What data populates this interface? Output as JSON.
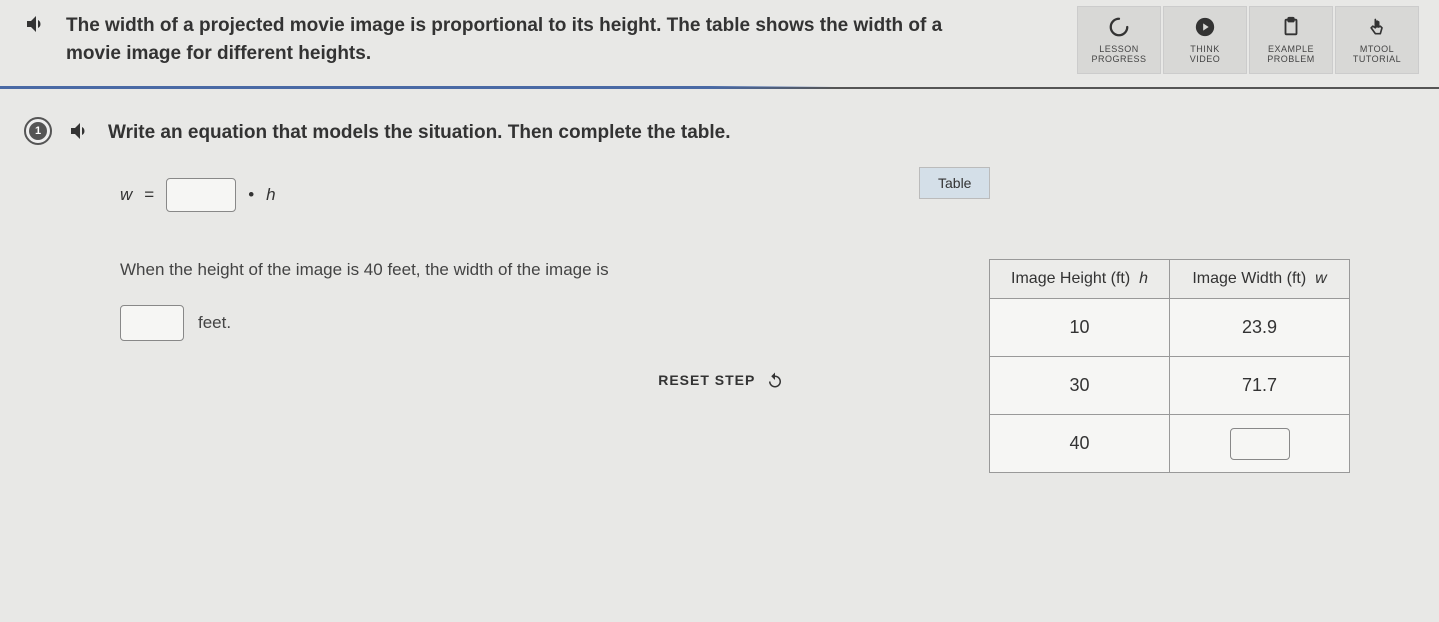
{
  "intro": "The width of a projected movie image is proportional to its height. The table shows the width of a movie image for different heights.",
  "toolbar": {
    "lesson_progress": "LESSON\nPROGRESS",
    "think_video": "THINK\nVIDEO",
    "example_problem": "EXAMPLE\nPROBLEM",
    "mtool_tutorial": "MTOOL\nTUTORIAL"
  },
  "step": {
    "number": "1",
    "prompt": "Write an equation that models the situation. Then complete the table.",
    "eq_lhs": "w",
    "eq_equals": "=",
    "eq_dot": "•",
    "eq_rhs": "h",
    "sentence": "When the height of the image is 40 feet, the width of the image is",
    "feet_label": "feet.",
    "reset_label": "RESET STEP"
  },
  "table": {
    "tab_label": "Table",
    "col1_label": "Image Height (ft)",
    "col1_var": "h",
    "col2_label": "Image Width (ft)",
    "col2_var": "w",
    "rows": [
      {
        "h": "10",
        "w": "23.9"
      },
      {
        "h": "30",
        "w": "71.7"
      },
      {
        "h": "40",
        "w": ""
      }
    ]
  }
}
